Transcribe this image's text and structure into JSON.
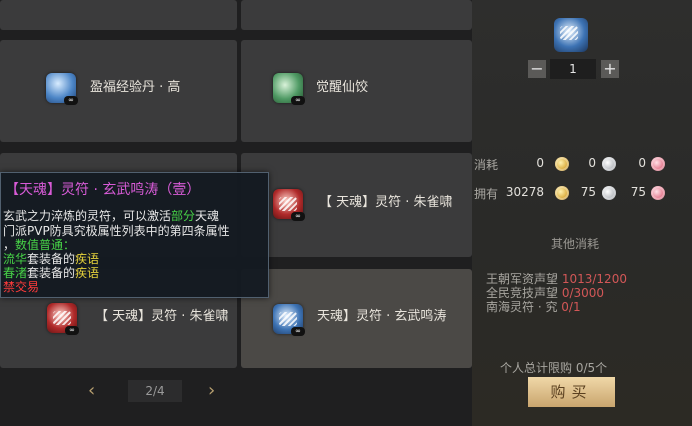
{
  "shop": {
    "items": [
      {
        "name": "盈福经验丹 · 高",
        "icon": "blue-orb-icon",
        "badge": "∞"
      },
      {
        "name": "觉醒仙饺",
        "icon": "green-dumpling-icon",
        "badge": "∞"
      },
      {
        "name": "【 天魂】灵符 · 朱雀啸",
        "icon": "red-talisman-icon",
        "badge": "∞"
      },
      {
        "name": "【 天魂】灵符 · 朱雀啸",
        "icon": "red-talisman-icon",
        "badge": "∞"
      },
      {
        "name": "天魂】灵符 · 玄武鸣涛",
        "icon": "blue-talisman-icon",
        "badge": "∞"
      }
    ],
    "pager": {
      "text": "2/4"
    }
  },
  "tooltip": {
    "title": "【天魂】灵符 · 玄武鸣涛（壹）",
    "desc_part1": "玄武之力淬炼的灵符，可以激活",
    "desc_highlight": "部分",
    "desc_part2": "天魂",
    "desc_line2": "门派PVP防具究极属性列表中的第四条属性",
    "desc_line3_prefix": "，",
    "desc_line3_green": "数值普通：",
    "set1_name": "流华",
    "set1_mid": "套装备的",
    "set1_skill": "疾语",
    "set2_name": "春渚",
    "set2_mid": "套装备的",
    "set2_skill": "疾语",
    "trade": "禁交易"
  },
  "panel": {
    "quantity": "1",
    "minus": "−",
    "plus": "+",
    "cost_label": "消耗",
    "cost_values": [
      "0",
      "0",
      "0"
    ],
    "own_label": "拥有",
    "own_values": [
      "30278",
      "75",
      "75"
    ],
    "other_cost_title": "其他消耗",
    "reputations": [
      {
        "label": "王朝军资声望",
        "value": "1013/1200"
      },
      {
        "label": "全民竞技声望",
        "value": "0/3000"
      },
      {
        "label": "南海灵符 · 究",
        "value": "0/1"
      }
    ],
    "limit_label": "个人总计限购",
    "limit_value": "0/5个",
    "buy_label": "购买",
    "colors": {
      "gold": "#d9a93a",
      "silver": "#b9bcc1",
      "pink": "#e4788d"
    }
  }
}
